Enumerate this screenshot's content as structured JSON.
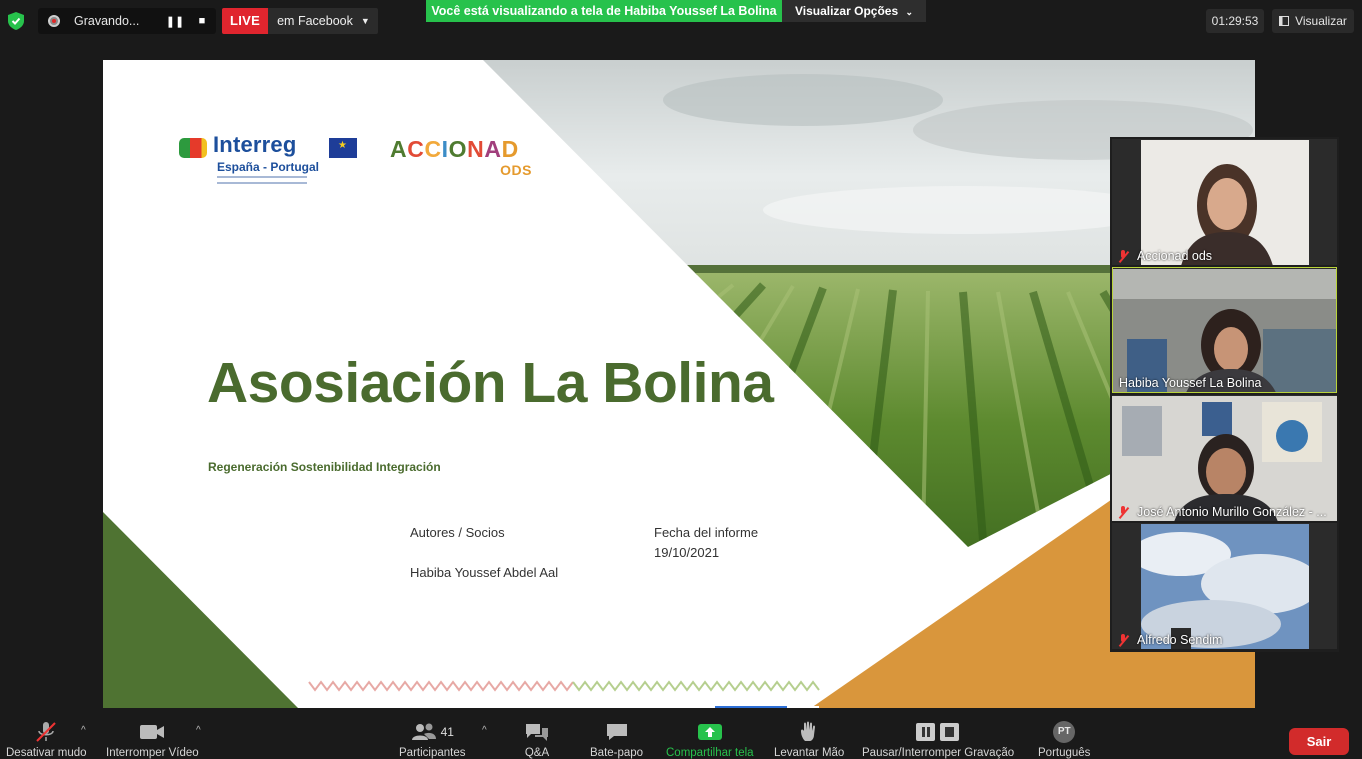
{
  "topbar": {
    "security_icon": "shield-check-icon",
    "recording_label": "Gravando...",
    "pause_icon": "pause-icon",
    "stop_icon": "stop-icon",
    "live_badge": "LIVE",
    "live_target": "em Facebook",
    "share_banner": "Você está visualizando a tela de Habiba Youssef La Bolina",
    "view_options": "Visualizar Opções",
    "timer": "01:29:53",
    "view_button": "Visualizar"
  },
  "slide": {
    "logo_interreg": "Interreg",
    "logo_interreg_sub": "España - Portugal",
    "logo_accionad": "ACCIONAD",
    "logo_accionad_sub": "ODS",
    "title": "Asosiación La Bolina",
    "subtitle": "Regeneración Sostenibilidad Integración",
    "authors_label": "Autores / Socios",
    "authors_value": "Habiba Youssef Abdel Aal",
    "date_label": "Fecha del informe",
    "date_value": "19/10/2021",
    "colors": {
      "green": "#4a6b2e",
      "orange": "#d9963c",
      "dark_green": "#4f7332"
    }
  },
  "participants": [
    {
      "name": "Accionad ods",
      "muted": true,
      "active": false
    },
    {
      "name": "Habiba Youssef La Bolina",
      "muted": false,
      "active": true
    },
    {
      "name": "José Antonio Murillo González - ...",
      "muted": true,
      "active": false
    },
    {
      "name": "Alfredo Sendim",
      "muted": true,
      "active": false
    }
  ],
  "toolbar": {
    "mute_label": "Desativar mudo",
    "video_label": "Interromper Vídeo",
    "participants_label": "Participantes",
    "participants_count": "41",
    "qa_label": "Q&A",
    "chat_label": "Bate-papo",
    "share_label": "Compartilhar tela",
    "raise_hand_label": "Levantar Mão",
    "recording_label": "Pausar/Interromper Gravação",
    "language_label": "Português",
    "language_code": "PT",
    "leave_label": "Sair"
  }
}
